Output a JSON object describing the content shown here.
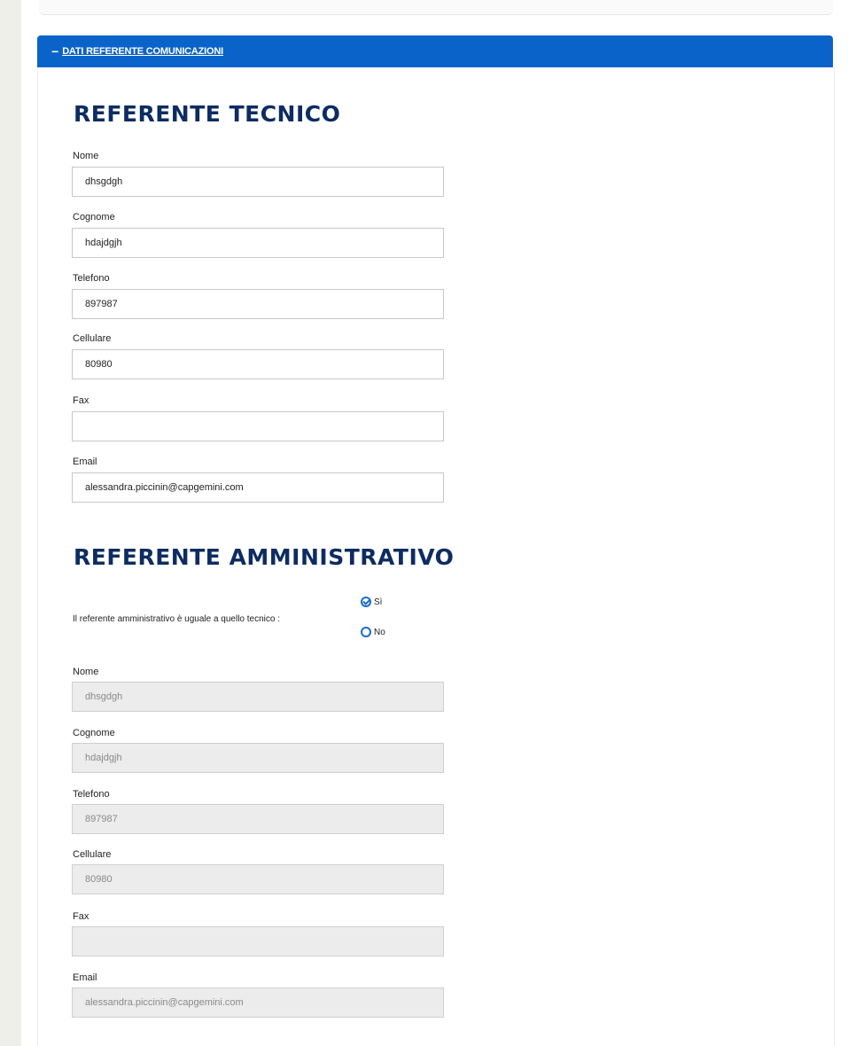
{
  "section": {
    "toggle": "−",
    "title": "DATI REFERENTE COMUNICAZIONI"
  },
  "tecnico": {
    "title": "REFERENTE TECNICO",
    "fields": [
      {
        "label": "Nome",
        "value": ""
      },
      {
        "label": "Cognome",
        "value": ""
      },
      {
        "label": "Telefono",
        "value": ""
      },
      {
        "label": "Cellulare",
        "value": ""
      },
      {
        "label": "Fax",
        "value": ""
      },
      {
        "label": "Email",
        "value": ""
      }
    ]
  },
  "amministrativo": {
    "title": "REFERENTE AMMINISTRATIVO",
    "same_question": "Il referente amministrativo è uguale a quello tecnico :",
    "options": [
      {
        "label": "Sì",
        "checked": true
      },
      {
        "label": "No",
        "checked": false
      }
    ],
    "fields": [
      {
        "label": "Nome",
        "value": ""
      },
      {
        "label": "Cognome",
        "value": ""
      },
      {
        "label": "Telefono",
        "value": ""
      },
      {
        "label": "Cellulare",
        "value": ""
      },
      {
        "label": "Fax",
        "value": ""
      },
      {
        "label": "Email",
        "value": ""
      }
    ]
  },
  "values": {
    "nome": "dhsgdgh",
    "cognome": "hdajdgjh",
    "telefono": "897987",
    "cellulare": "80980",
    "fax": "",
    "email": "alessandra.piccinin@capgemini.com"
  },
  "colors": {
    "header_bg": "#0a63c9",
    "title_text": "#0d2c62",
    "radio_accent": "#1a6bd0",
    "disabled_bg": "#ececec"
  }
}
